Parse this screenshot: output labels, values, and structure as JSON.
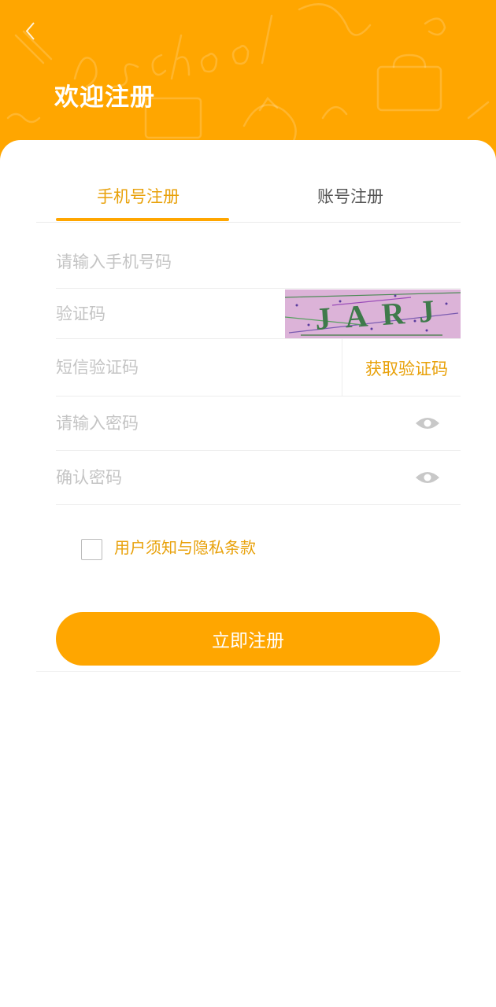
{
  "header": {
    "title": "欢迎注册",
    "background_color": "#FFA600",
    "back_icon": "chevron-left-icon"
  },
  "tabs": [
    {
      "label": "手机号注册",
      "active": true
    },
    {
      "label": "账号注册",
      "active": false
    }
  ],
  "form": {
    "phone": {
      "placeholder": "请输入手机号码",
      "value": ""
    },
    "captcha": {
      "placeholder": "验证码",
      "value": "",
      "image_text": "JARJ"
    },
    "sms_code": {
      "placeholder": "短信验证码",
      "value": "",
      "button_label": "获取验证码"
    },
    "password": {
      "placeholder": "请输入密码",
      "value": "",
      "icon": "eye-icon"
    },
    "confirm_password": {
      "placeholder": "确认密码",
      "value": "",
      "icon": "eye-icon"
    }
  },
  "agreement": {
    "label": "用户须知与隐私条款",
    "checked": false
  },
  "submit_label": "立即注册",
  "colors": {
    "accent": "#FFA600",
    "accent_text": "#E8A10A",
    "placeholder": "#C4C4C4"
  }
}
